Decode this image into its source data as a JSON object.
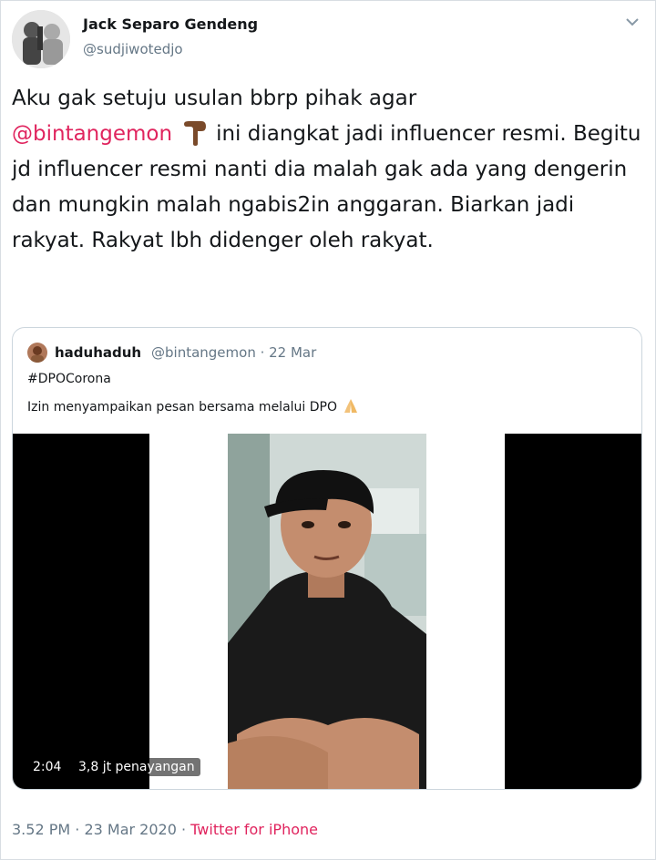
{
  "tweet": {
    "author_name": "Jack Separo Gendeng",
    "author_handle": "@sudjiwotedjo",
    "text_part1": "Aku gak setuju usulan bbrp pihak agar",
    "mention": "@bintangemon",
    "text_part2": "ini diangkat jadi influencer resmi. Begitu jd influencer resmi nanti dia malah gak ada yang dengerin dan mungkin malah ngabis2in anggaran. Biarkan jadi rakyat. Rakyat lbh didenger oleh rakyat.",
    "time": "3.52 PM",
    "separator": "·",
    "date": "23 Mar 2020",
    "source": "Twitter for iPhone"
  },
  "quoted": {
    "name": "haduhaduh",
    "handle_date": "@bintangemon · 22 Mar",
    "hashtag": "#DPOCorona",
    "message": "Izin menyampaikan pesan bersama melalui DPO",
    "video": {
      "duration": "2:04",
      "views": "3,8 jt penayangan"
    }
  },
  "icons": {
    "menu": "chevron-down-icon",
    "emoji_point": "point-down-emoji",
    "emoji_pray": "pray-emoji"
  },
  "colors": {
    "mention": "#e0245e",
    "secondary_text": "#657786",
    "border": "#ccd6dd"
  }
}
